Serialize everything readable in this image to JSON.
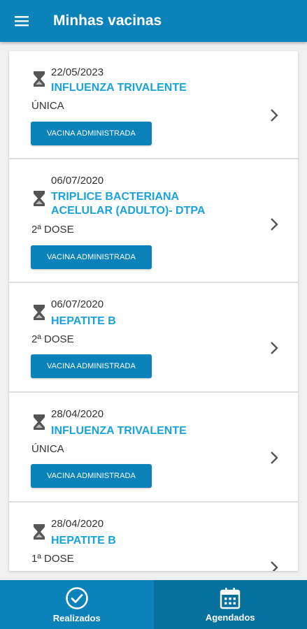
{
  "header": {
    "title": "Minhas vacinas"
  },
  "vaccines": [
    {
      "date": "22/05/2023",
      "name_lines": [
        "INFLUENZA TRIVALENTE"
      ],
      "dose": "ÚNICA",
      "status": "VACINA ADMINISTRADA"
    },
    {
      "date": "06/07/2020",
      "name_lines": [
        "TRIPLICE BACTERIANA",
        "ACELULAR (ADULTO)- DTPA"
      ],
      "dose": "2ª DOSE",
      "status": "VACINA ADMINISTRADA"
    },
    {
      "date": "06/07/2020",
      "name_lines": [
        "HEPATITE B"
      ],
      "dose": "2ª DOSE",
      "status": "VACINA ADMINISTRADA"
    },
    {
      "date": "28/04/2020",
      "name_lines": [
        "INFLUENZA TRIVALENTE"
      ],
      "dose": "ÚNICA",
      "status": "VACINA ADMINISTRADA"
    },
    {
      "date": "28/04/2020",
      "name_lines": [
        "HEPATITE B"
      ],
      "dose": "1ª DOSE",
      "status": ""
    }
  ],
  "bottom_nav": {
    "tabs": [
      {
        "label": "Realizados",
        "icon": "check-circle-icon",
        "active": true
      },
      {
        "label": "Agendados",
        "icon": "calendar-icon",
        "active": false
      }
    ]
  },
  "colors": {
    "primary": "#0b82b9",
    "primary_dark": "#06709f",
    "accent_text": "#1aa3d9"
  }
}
